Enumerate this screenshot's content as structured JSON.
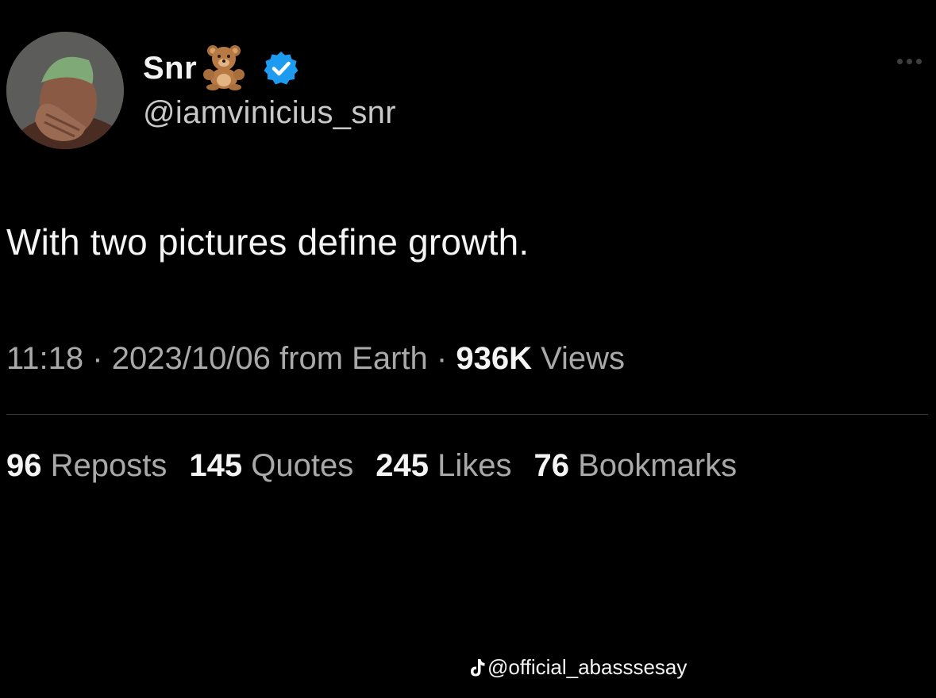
{
  "author": {
    "display_name": "Snr",
    "handle": "@iamvinicius_snr",
    "avatar_icon": "person-facepalm-avatar",
    "name_emoji_icon": "teddy-bear-icon",
    "verified_icon": "verified-badge-icon",
    "verified_color": "#1d9bf0"
  },
  "tweet": {
    "text": "With two pictures define growth.",
    "time": "11:18",
    "separator": "·",
    "date": "2023/10/06 from Earth",
    "views_count": "936K",
    "views_label": "Views"
  },
  "stats": [
    {
      "count": "96",
      "label": "Reposts"
    },
    {
      "count": "145",
      "label": "Quotes"
    },
    {
      "count": "245",
      "label": "Likes"
    },
    {
      "count": "76",
      "label": "Bookmarks"
    }
  ],
  "more_icon": "more-options-icon",
  "watermark": {
    "icon": "tiktok-logo-icon",
    "text": "@official_abasssesay"
  }
}
